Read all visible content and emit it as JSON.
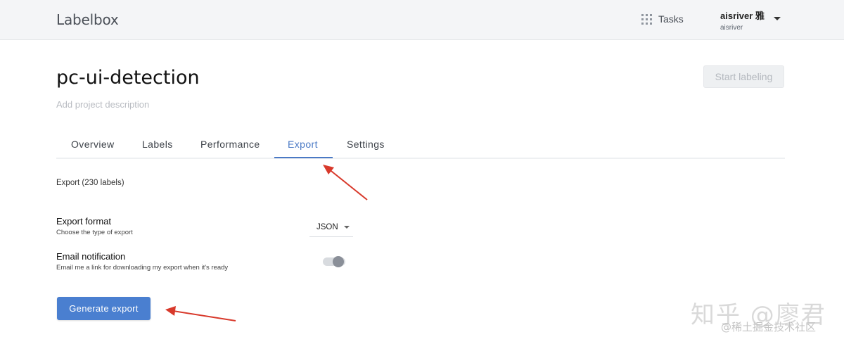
{
  "header": {
    "logo": "Labelbox",
    "tasks_label": "Tasks",
    "user_name": "aisriver 雅",
    "user_handle": "aisriver"
  },
  "project": {
    "title": "pc-ui-detection",
    "description_placeholder": "Add project description",
    "start_button": "Start labeling"
  },
  "tabs": [
    {
      "label": "Overview",
      "active": false
    },
    {
      "label": "Labels",
      "active": false
    },
    {
      "label": "Performance",
      "active": false
    },
    {
      "label": "Export",
      "active": true
    },
    {
      "label": "Settings",
      "active": false
    }
  ],
  "export": {
    "count_text": "Export (230 labels)",
    "format_title": "Export format",
    "format_sub": "Choose the type of export",
    "format_value": "JSON",
    "email_title": "Email notification",
    "email_sub": "Email me a link for downloading my export when it's ready",
    "email_enabled": false,
    "generate_button": "Generate export"
  },
  "colors": {
    "accent": "#4a79c5",
    "button": "#4a7fd0",
    "annotation_arrow": "#d8392b"
  },
  "watermark": {
    "main": "知乎 @廖君",
    "sub": "@稀土掘金技术社区"
  }
}
